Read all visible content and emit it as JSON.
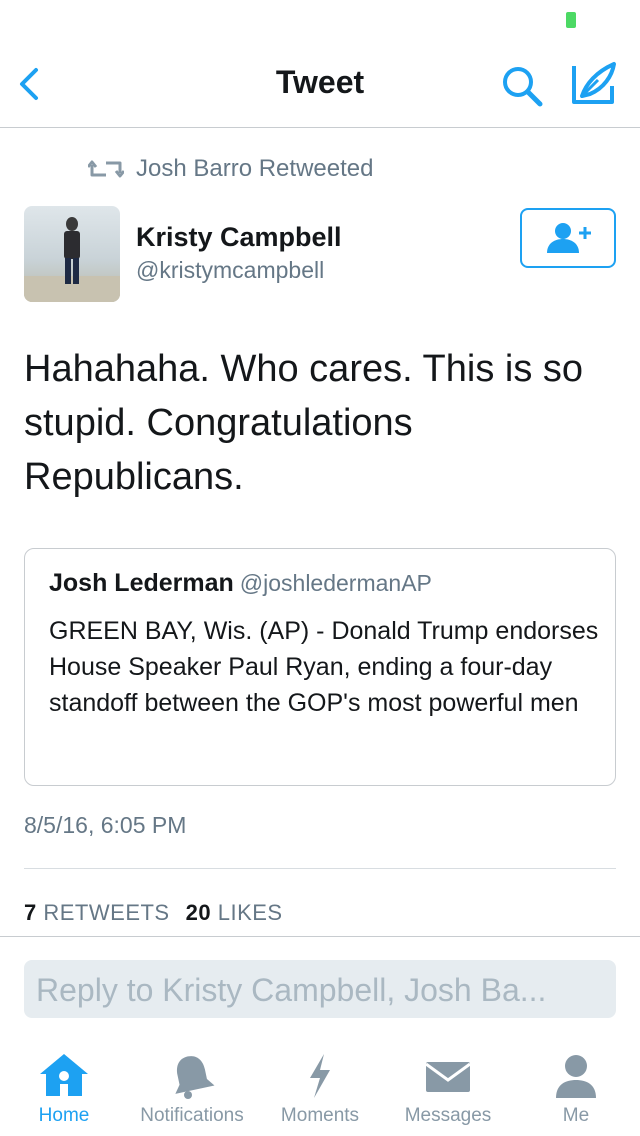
{
  "nav": {
    "title": "Tweet",
    "back_icon": "chevron-left-icon",
    "search_icon": "search-icon",
    "compose_icon": "compose-icon"
  },
  "retweet": {
    "text": "Josh Barro Retweeted",
    "icon": "retweet-icon"
  },
  "author": {
    "name": "Kristy Campbell",
    "handle": "@kristymcampbell"
  },
  "follow_button": {
    "icon": "add-user-icon"
  },
  "tweet": {
    "text": "Hahahaha. Who cares. This is so stupid. Congratulations Republicans."
  },
  "quote": {
    "name": "Josh Lederman",
    "handle": "@joshledermanAP",
    "text": "GREEN BAY, Wis. (AP) - Donald Trump endorses House Speaker Paul Ryan, ending a four-day standoff between the GOP's most powerful men"
  },
  "timestamp": "8/5/16, 6:05 PM",
  "stats": {
    "retweets_count": "7",
    "retweets_label": "RETWEETS",
    "likes_count": "20",
    "likes_label": "LIKES"
  },
  "reply": {
    "placeholder": "Reply to Kristy Campbell, Josh Ba..."
  },
  "tabs": [
    {
      "label": "Home",
      "icon": "home-icon",
      "active": true
    },
    {
      "label": "Notifications",
      "icon": "bell-icon",
      "active": false
    },
    {
      "label": "Moments",
      "icon": "lightning-icon",
      "active": false
    },
    {
      "label": "Messages",
      "icon": "envelope-icon",
      "active": false
    },
    {
      "label": "Me",
      "icon": "person-icon",
      "active": false
    }
  ],
  "colors": {
    "accent": "#1da1f2",
    "text_primary": "#14171a",
    "text_secondary": "#657786",
    "tab_inactive": "#8899a6",
    "battery": "#4cd964"
  }
}
